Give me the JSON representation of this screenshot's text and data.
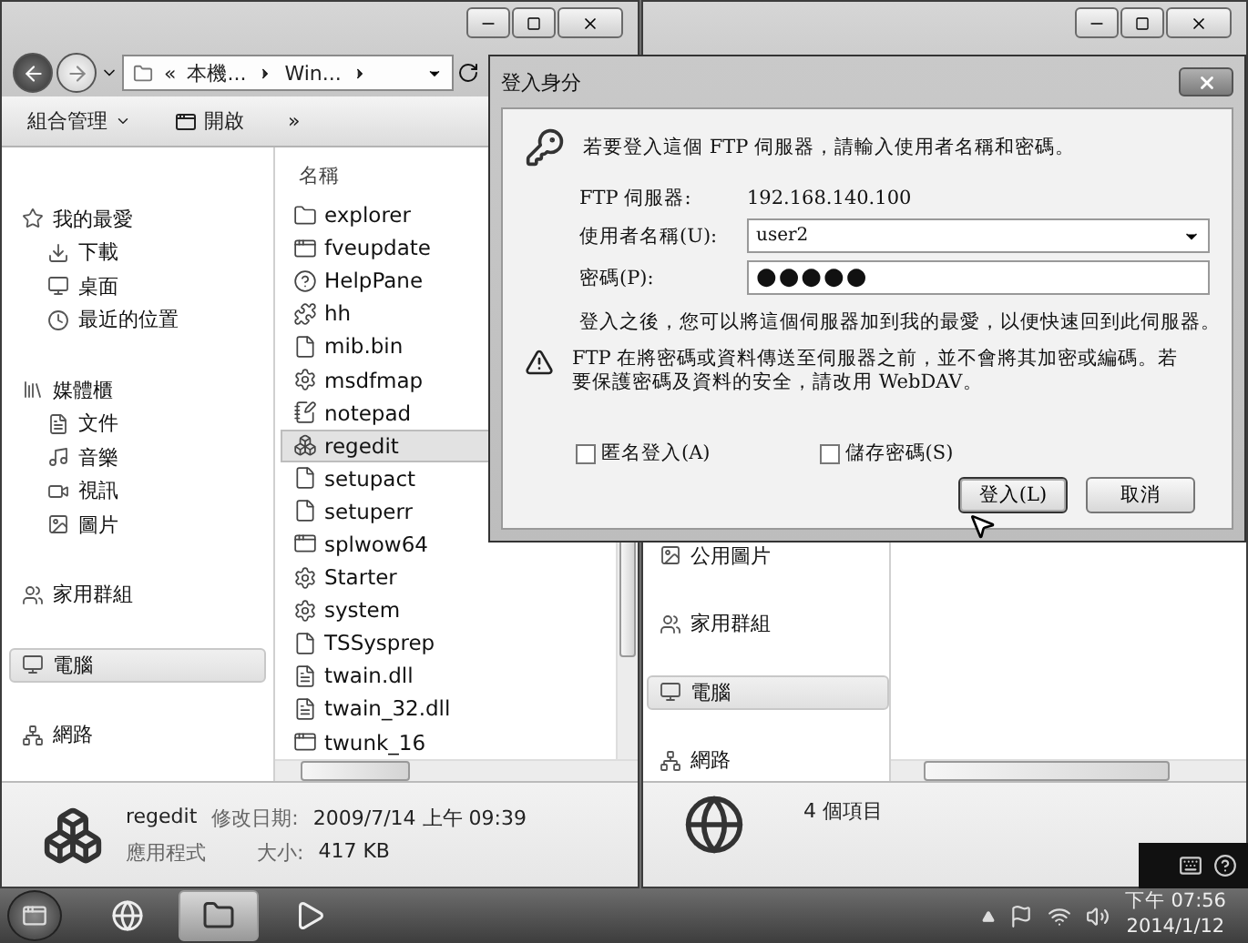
{
  "left_window": {
    "address": {
      "prefix": "«",
      "segments": [
        "本機...",
        "Win..."
      ]
    },
    "toolbar": [
      {
        "label": "組合管理",
        "kind": "menu"
      },
      {
        "label": "開啟",
        "kind": "open"
      },
      {
        "label": "»",
        "kind": "more"
      }
    ],
    "nav": [
      {
        "label": "我的最愛",
        "kind": "star",
        "selected": false,
        "children": [
          {
            "label": "下載",
            "kind": "download",
            "selected": false
          },
          {
            "label": "桌面",
            "kind": "desktop",
            "selected": false
          },
          {
            "label": "最近的位置",
            "kind": "recent",
            "selected": false
          }
        ]
      },
      {
        "label": "媒體櫃",
        "kind": "library",
        "selected": false,
        "children": [
          {
            "label": "文件",
            "kind": "document",
            "selected": false
          },
          {
            "label": "音樂",
            "kind": "music",
            "selected": false
          },
          {
            "label": "視訊",
            "kind": "video",
            "selected": false
          },
          {
            "label": "圖片",
            "kind": "picture",
            "selected": false
          }
        ]
      },
      {
        "label": "家用群組",
        "kind": "homegroup",
        "selected": false
      },
      {
        "label": "電腦",
        "kind": "computer",
        "selected": true
      },
      {
        "label": "網路",
        "kind": "network",
        "selected": false
      }
    ],
    "column_header": "名稱",
    "files": [
      {
        "name": "explorer",
        "kind": "folder",
        "selected": false
      },
      {
        "name": "fveupdate",
        "kind": "app",
        "selected": false
      },
      {
        "name": "HelpPane",
        "kind": "help",
        "selected": false
      },
      {
        "name": "hh",
        "kind": "helpdoc",
        "selected": false
      },
      {
        "name": "mib.bin",
        "kind": "file",
        "selected": false
      },
      {
        "name": "msdfmap",
        "kind": "settings",
        "selected": false
      },
      {
        "name": "notepad",
        "kind": "notepad",
        "selected": false
      },
      {
        "name": "regedit",
        "kind": "registry",
        "selected": true
      },
      {
        "name": "setupact",
        "kind": "file",
        "selected": false
      },
      {
        "name": "setuperr",
        "kind": "file",
        "selected": false
      },
      {
        "name": "splwow64",
        "kind": "app",
        "selected": false
      },
      {
        "name": "Starter",
        "kind": "settings",
        "selected": false
      },
      {
        "name": "system",
        "kind": "settings",
        "selected": false
      },
      {
        "name": "TSSysprep",
        "kind": "file",
        "selected": false
      },
      {
        "name": "twain.dll",
        "kind": "dll",
        "selected": false
      },
      {
        "name": "twain_32.dll",
        "kind": "dll",
        "selected": false
      },
      {
        "name": "twunk_16",
        "kind": "app",
        "selected": false
      }
    ],
    "details": {
      "name": "regedit",
      "modified_label": "修改日期:",
      "modified": "2009/7/14 上午 09:39",
      "type": "應用程式",
      "size_label": "大小:",
      "size": "417 KB"
    }
  },
  "right_window": {
    "nav": [
      {
        "label": "公用圖片",
        "kind": "picture",
        "selected": false
      },
      {
        "label": "家用群組",
        "kind": "homegroup",
        "selected": false
      },
      {
        "label": "電腦",
        "kind": "computer",
        "selected": true
      },
      {
        "label": "網路",
        "kind": "network",
        "selected": false
      }
    ],
    "status": "4 個項目"
  },
  "dialog": {
    "title": "登入身分",
    "intro": "若要登入這個 FTP 伺服器，請輸入使用者名稱和密碼。",
    "server_label": "FTP 伺服器:",
    "server": "192.168.140.100",
    "username_label": "使用者名稱(U):",
    "username": "user2",
    "password_label": "密碼(P):",
    "password": "●●●●●",
    "note": "登入之後，您可以將這個伺服器加到我的最愛，以便快速回到此伺服器。",
    "warning": "FTP 在將密碼或資料傳送至伺服器之前，並不會將其加密或編碼。若要保護密碼及資料的安全，請改用 WebDAV。",
    "checkboxes": [
      {
        "label": "匿名登入(A)",
        "checked": false
      },
      {
        "label": "儲存密碼(S)",
        "checked": false
      }
    ],
    "buttons": [
      {
        "label": "登入(L)",
        "kind": "default"
      },
      {
        "label": "取消",
        "kind": "normal"
      }
    ]
  },
  "taskbar": {
    "apps": [
      {
        "kind": "browser",
        "selected": false
      },
      {
        "kind": "explorer",
        "selected": true
      },
      {
        "kind": "media",
        "selected": false
      }
    ],
    "time": "下午 07:56",
    "date": "2014/1/12"
  }
}
